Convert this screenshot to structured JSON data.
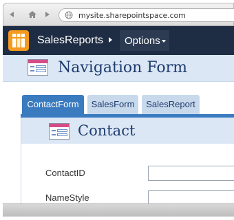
{
  "browser": {
    "url": "mysite.sharepointspace.com",
    "back_icon": "back-arrow-icon",
    "home_icon": "home-icon",
    "forward_icon": "forward-arrow-icon",
    "site_icon": "globe-icon"
  },
  "appbar": {
    "title": "SalesReports",
    "options_label": "Options",
    "colors": {
      "bar": "#1f2d44",
      "logo": "#f39a1f"
    }
  },
  "navigation_form": {
    "title": "Navigation Form",
    "tabs": [
      {
        "label": "ContactForm",
        "active": true
      },
      {
        "label": "SalesForm",
        "active": false
      },
      {
        "label": "SalesReport",
        "active": false
      }
    ]
  },
  "contact_form": {
    "title": "Contact",
    "fields": [
      {
        "label": "ContactID",
        "value": ""
      },
      {
        "label": "NameStyle",
        "value": ""
      }
    ]
  },
  "colors": {
    "header_bg": "#dbe7f5",
    "title_text": "#1f3c6e",
    "active_tab": "#3a7bc0",
    "inactive_tab": "#c8d9ec"
  }
}
